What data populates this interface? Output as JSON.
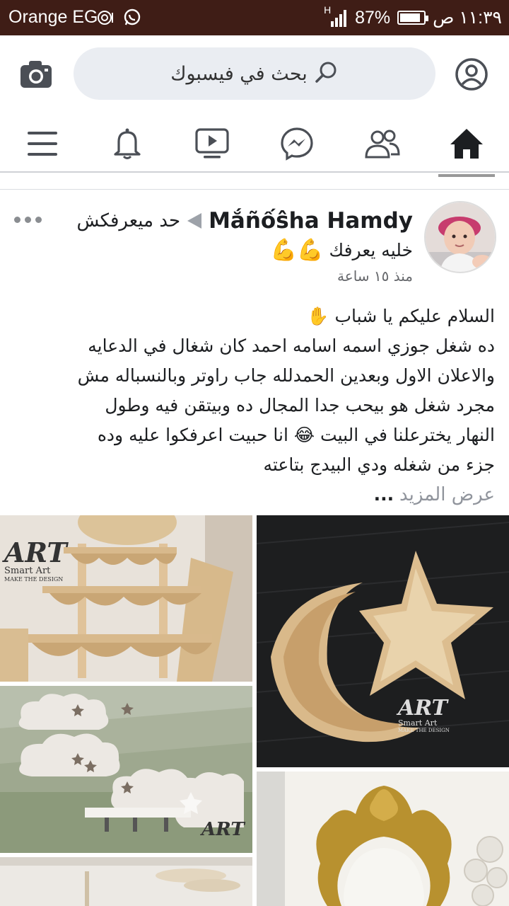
{
  "status_bar": {
    "carrier": "Orange EG",
    "network": "H",
    "battery": "87%",
    "battery_level": 0.87,
    "time": "١١:٣٩ ص"
  },
  "header": {
    "search_placeholder": "بحث في فيسبوك",
    "icons": [
      "camera-icon",
      "search-icon",
      "profile-icon"
    ]
  },
  "nav": {
    "tabs": [
      "home-icon",
      "friends-icon",
      "messenger-icon",
      "watch-icon",
      "notifications-icon",
      "menu-icon"
    ],
    "active_tab": "home-icon",
    "active_color": "#1c1e21"
  },
  "post": {
    "author": "Mắñốŝha Hamdy",
    "group": "حد ميعرفكش",
    "subtitle": "خليه يعرفك",
    "subtitle_emoji": "💪💪",
    "time": "منذ ١٥ ساعة",
    "body_lines": [
      "السلام عليكم يا شباب ✋",
      "ده شغل جوزي اسمه اسامه احمد كان شغال في الدعايه",
      "والاعلان الاول وبعدين الحمدلله جاب راوتر وبالنسباله مش",
      "مجرد شغل هو بيحب جدا المجال ده وبيتقن فيه وطول",
      "النهار يخترعلنا في البيت 😂 انا حبيت اعرفكوا عليه وده",
      "جزء من شغله ودي البيدج بتاعته"
    ],
    "see_more": "عرض المزيد",
    "ellipsis": "...",
    "watermark": "ART",
    "watermark_sub": "Smart Art",
    "watermark_tag": "MAKE THE DESIGN"
  }
}
